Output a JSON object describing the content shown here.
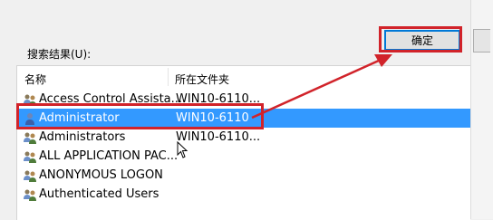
{
  "search_label": "搜索结果(U):",
  "ok_button_label": "确定",
  "columns": {
    "name": "名称",
    "folder": "所在文件夹"
  },
  "rows": [
    {
      "name": "Access Control Assista...",
      "folder": "WIN10-6110...",
      "icon": "group-users-icon",
      "selected": false
    },
    {
      "name": "Administrator",
      "folder": "WIN10-6110",
      "icon": "user-icon",
      "selected": true
    },
    {
      "name": "Administrators",
      "folder": "WIN10-6110...",
      "icon": "group-users-icon",
      "selected": false
    },
    {
      "name": "ALL APPLICATION PAC...",
      "folder": "",
      "icon": "group-users-icon",
      "selected": false
    },
    {
      "name": "ANONYMOUS LOGON",
      "folder": "",
      "icon": "group-users-icon",
      "selected": false
    },
    {
      "name": "Authenticated Users",
      "folder": "",
      "icon": "group-users-icon",
      "selected": false
    }
  ],
  "colors": {
    "selection": "#3399ff",
    "annotation_red": "#d1232a",
    "button_border": "#0078d7"
  }
}
